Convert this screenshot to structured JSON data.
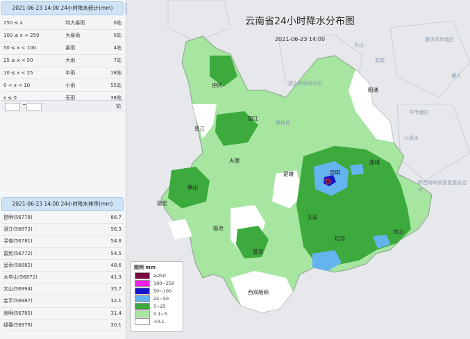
{
  "stats": {
    "title": "2021-06-23 14:00 24小时降水统计(mm)",
    "rows": [
      {
        "range": "250 ≤ x",
        "level": "特大暴雨",
        "count": "0站"
      },
      {
        "range": "100 ≤ x < 250",
        "level": "大暴雨",
        "count": "0站"
      },
      {
        "range": "50 ≤ x < 100",
        "level": "暴雨",
        "count": "4站"
      },
      {
        "range": "25 ≤ x < 50",
        "level": "大雨",
        "count": "7站"
      },
      {
        "range": "10 ≤ x < 25",
        "level": "中雨",
        "count": "18站"
      },
      {
        "range": "0 < x < 10",
        "level": "小雨",
        "count": "55站"
      },
      {
        "range": "x ≤ 0",
        "level": "无雨",
        "count": "38站"
      }
    ],
    "filter_sep": "~",
    "filter_unit": "站"
  },
  "ranking": {
    "title": "2021-06-23 14:00 24小时降水排序(mm)",
    "rows": [
      {
        "station": "昆明(56778)",
        "value": "86.7"
      },
      {
        "station": "澄江(56873)",
        "value": "56.3"
      },
      {
        "station": "寻甸(56781)",
        "value": "54.8"
      },
      {
        "station": "富民(56772)",
        "value": "54.5"
      },
      {
        "station": "呈贡(56882)",
        "value": "48.6"
      },
      {
        "station": "太华山(56872)",
        "value": "41.3"
      },
      {
        "station": "文山(56994)",
        "value": "35.7"
      },
      {
        "station": "金平(56987)",
        "value": "32.1"
      },
      {
        "station": "嵩明(56785)",
        "value": "31.4"
      },
      {
        "station": "绿春(56978)",
        "value": "30.1"
      }
    ]
  },
  "map": {
    "title": "云南省24小时降水分布图",
    "subtitle": "2021-06-23 14:00",
    "legend": {
      "title": "图例 mm",
      "items": [
        {
          "label": "≥250",
          "color": "#7a0a3c"
        },
        {
          "label": "100~250",
          "color": "#f01ee6"
        },
        {
          "label": "50~100",
          "color": "#1414c8"
        },
        {
          "label": "25~50",
          "color": "#64b4f0"
        },
        {
          "label": "5~25",
          "color": "#3caa3c"
        },
        {
          "label": "0.1~5",
          "color": "#a6e6a0"
        },
        {
          "label": "<0.1",
          "color": "#ffffff"
        }
      ]
    },
    "places": [
      "德宏",
      "保山",
      "临沧",
      "普洱",
      "西双版纳",
      "大理",
      "丽江",
      "迪庆",
      "怒江",
      "楚雄",
      "昆明",
      "曲靖",
      "昭通",
      "玉溪",
      "红河",
      "文山"
    ],
    "neighbors": [
      "凉山彝族自治州",
      "宜宾",
      "乐山",
      "毕节地区",
      "六盘水",
      "重庆市市辖区",
      "黔西南布依族苗族自治州",
      "遵义",
      "攀枝花"
    ]
  }
}
